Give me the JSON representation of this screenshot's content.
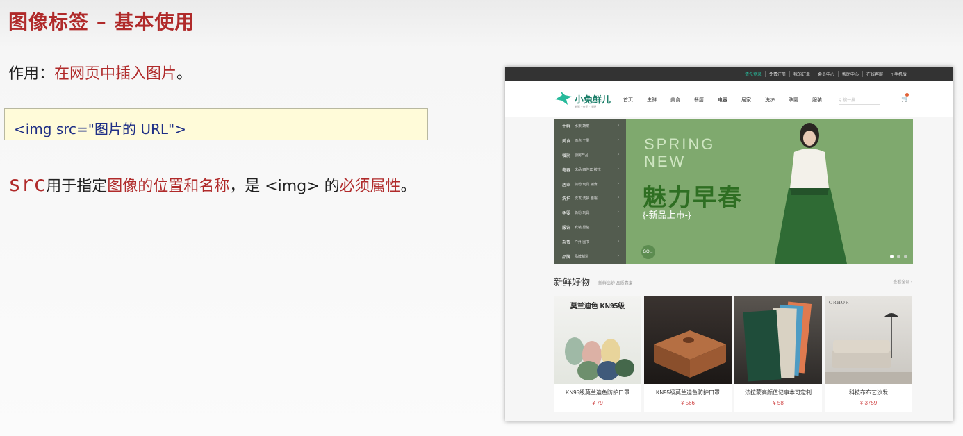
{
  "slide": {
    "title": "图像标签 – 基本使用",
    "purpose_label": "作用：",
    "purpose_text": "在网页中插入图片",
    "purpose_end": "。",
    "code": "<img  src=\"图片的 URL\">",
    "desc_src": "src",
    "desc_1": "用于指定",
    "desc_2": "图像的位置和名称",
    "desc_3": "，是 <img> 的",
    "desc_4": "必须属性",
    "desc_5": "。"
  },
  "site": {
    "topbar": [
      "请先登录",
      "免费注册",
      "我的订单",
      "会员中心",
      "帮助中心",
      "在线客服",
      "▯ 手机版"
    ],
    "logo_text": "小兔鲜儿",
    "logo_sub": "新鲜 · 亲民 · 快捷",
    "nav": [
      "首页",
      "生鲜",
      "美食",
      "餐厨",
      "电器",
      "居家",
      "洗护",
      "孕婴",
      "服装"
    ],
    "search_placeholder": "搜一搜",
    "categories": [
      {
        "main": "生鲜",
        "sub": "水果 蔬菜"
      },
      {
        "main": "美食",
        "sub": "面点 干果"
      },
      {
        "main": "餐厨",
        "sub": "厨房产品"
      },
      {
        "main": "电器",
        "sub": "床品 四件套 被枕"
      },
      {
        "main": "居家",
        "sub": "奶粉 玩具 辅食"
      },
      {
        "main": "洗护",
        "sub": "洗发 洗护 面霜"
      },
      {
        "main": "孕婴",
        "sub": "奶粉 玩具"
      },
      {
        "main": "服饰",
        "sub": "女装 男装"
      },
      {
        "main": "杂货",
        "sub": "户外 图书"
      },
      {
        "main": "品牌",
        "sub": "品牌制造"
      }
    ],
    "banner": {
      "line1": "SPRING",
      "line2": "NEW",
      "big": "魅力早春",
      "tag": "{-新品上市-}",
      "go": "GO→"
    },
    "section": {
      "title": "新鲜好物",
      "sub": "新鲜出炉 品质靠谱",
      "more": "查看全部 ›"
    },
    "products": [
      {
        "name": "KN95级莫兰迪色防护口罩",
        "price": "¥ 79"
      },
      {
        "name": "KN95级莫兰迪色防护口罩",
        "price": "¥ 566"
      },
      {
        "name": "法拉蒙高颜值记事本可定制",
        "price": "¥ 58"
      },
      {
        "name": "科技布布艺沙发",
        "price": "¥ 3759"
      }
    ],
    "product1_banner": "莫兰迪色 KN95级",
    "product4_brand": "ORHOR"
  },
  "colors": {
    "accent": "#b02a2a",
    "code": "#1f2f86",
    "site_accent": "#27ba9b"
  }
}
